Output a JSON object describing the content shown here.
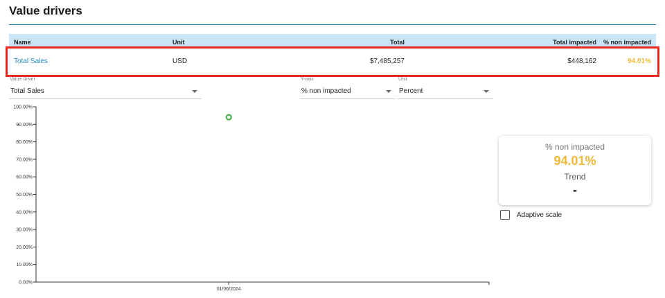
{
  "header": {
    "title": "Value drivers"
  },
  "table": {
    "columns": {
      "name": "Name",
      "unit": "Unit",
      "total": "Total",
      "total_impacted": "Total impacted",
      "pct_non_impacted": "% non impacted"
    },
    "rows": [
      {
        "name": "Total Sales",
        "unit": "USD",
        "total": "$7,485,257",
        "total_impacted": "$448,162",
        "pct_non_impacted": "94.01%"
      }
    ]
  },
  "controls": {
    "value_driver": {
      "label": "Value driver",
      "value": "Total Sales"
    },
    "y_axis": {
      "label": "Y-axis",
      "value": "% non impacted"
    },
    "unit": {
      "label": "Unit",
      "value": "Percent"
    }
  },
  "summary": {
    "metric": "% non impacted",
    "value": "94.01%",
    "trend_label": "Trend",
    "trend_value": "-"
  },
  "adaptive_scale": {
    "label": "Adaptive scale",
    "checked": false
  },
  "colors": {
    "accent": "#2a8cc4",
    "header_bg": "#c9e6f6",
    "highlight": "#e8261e",
    "value": "#f0b93a",
    "point": "#4caf50"
  },
  "chart_data": {
    "type": "scatter",
    "title": "",
    "xlabel": "",
    "ylabel": "",
    "x_ticks": [
      "01/06/2024"
    ],
    "y_ticks": [
      "0.00%",
      "10.00%",
      "20.00%",
      "30.00%",
      "40.00%",
      "50.00%",
      "60.00%",
      "70.00%",
      "80.00%",
      "90.00%",
      "100.00%"
    ],
    "ylim": [
      0,
      100
    ],
    "grid": false,
    "series": [
      {
        "points": [
          {
            "x": "01/06/2024",
            "y": 94.01
          }
        ]
      }
    ]
  }
}
